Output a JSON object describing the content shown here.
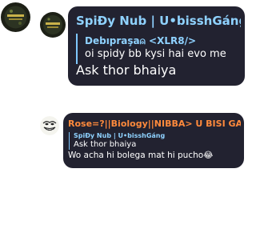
{
  "messages": [
    {
      "sender": "SpiÐy Nub | U•bisshGáng",
      "reply": {
        "name": "Debıpraşa⍝ <XLR8/>",
        "text": "oi spidy bb kysi hai evo me"
      },
      "text": "Ask thor bhaiya"
    },
    {
      "sender": "Rose=?||Biology||NIBBA> U BISI GAN...",
      "reply": {
        "name": "SpiÐy Nub | U•bisshGáng",
        "text": "Ask thor bhaiya"
      },
      "text": "Wo acha hi bolega mat hi pucho😂"
    }
  ],
  "colors": {
    "bubble_bg": "#222230",
    "sender_1": "#8fd2ff",
    "sender_2": "#ff8a3c",
    "reply_accent": "#7ec8ff",
    "text": "#ffffff"
  },
  "icons": {
    "avatar_1": "avatar-image",
    "avatar_2": "avatar-image",
    "avatar_3": "troll-face-avatar"
  }
}
